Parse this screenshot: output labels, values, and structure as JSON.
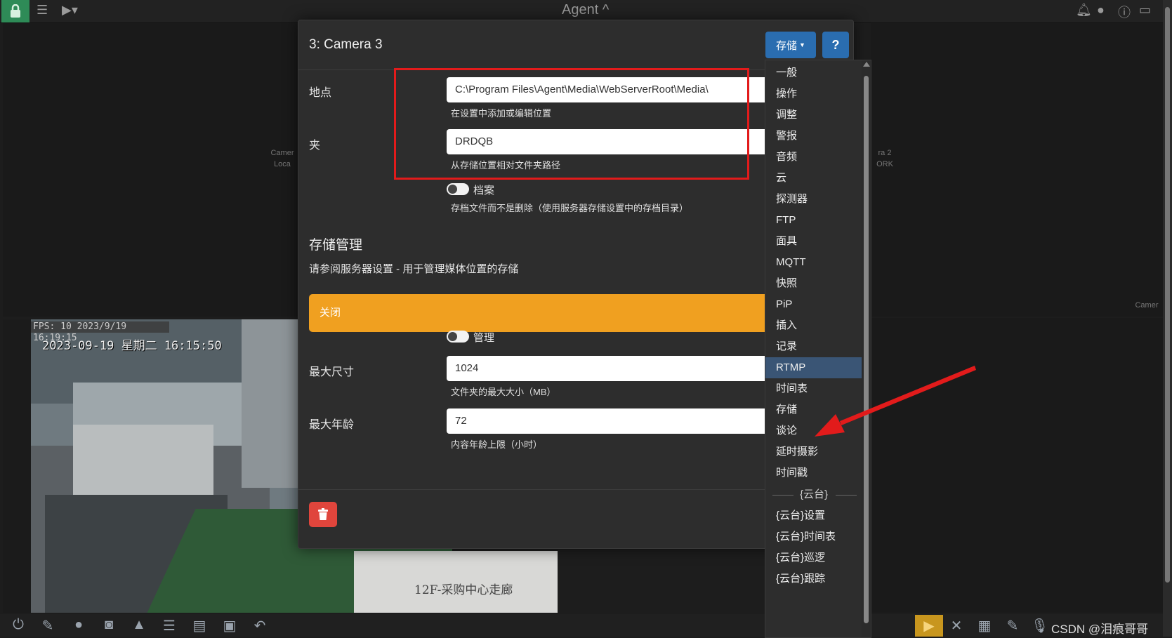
{
  "topbar": {
    "title": "Agent",
    "title_caret": "^"
  },
  "background_tiles": {
    "left_label_line1": "Camer",
    "left_label_line2": "Loca",
    "right_label_line1": "ra 2",
    "right_label_line2": "ORK",
    "right_corner_label": "Camer"
  },
  "feed": {
    "fps_text": "FPS: 10 2023/9/19 16:19:15",
    "osd_time": "2023-09-19 星期二 16:15:50",
    "osd_location": "12F-采购中心走廊"
  },
  "modal": {
    "title": "3: Camera 3",
    "storage_button": "存储",
    "help_button": "?",
    "location_label": "地点",
    "location_value": "C:\\Program Files\\Agent\\Media\\WebServerRoot\\Media\\",
    "location_hint": "在设置中添加或编辑位置",
    "folder_label": "夹",
    "folder_value": "DRDQB",
    "folder_hint": "从存储位置相对文件夹路径",
    "archive_label": "档案",
    "archive_hint": "存档文件而不是删除（使用服务器存储设置中的存档目录）",
    "section_title": "存储管理",
    "section_text": "请参阅服务器设置 - 用于管理媒体位置的存储",
    "warning_text": "关闭",
    "manage_label": "管理",
    "max_size_label": "最大尺寸",
    "max_size_value": "1024",
    "max_size_hint": "文件夹的最大大小（MB）",
    "max_age_label": "最大年龄",
    "max_age_value": "72",
    "max_age_hint": "内容年龄上限（小时）"
  },
  "dropdown": {
    "items": [
      "一般",
      "操作",
      "调整",
      "警报",
      "音频",
      "云",
      "探测器",
      "FTP",
      "面具",
      "MQTT",
      "快照",
      "PiP",
      "插入",
      "记录",
      "RTMP",
      "时间表",
      "存储",
      "谈论",
      "延时摄影",
      "时间戳"
    ],
    "active_item": "RTMP",
    "ptz_header": "{云台}",
    "ptz_items": [
      "{云台}设置",
      "{云台}时间表",
      "{云台}巡逻",
      "{云台}跟踪"
    ]
  },
  "watermark": "CSDN @泪痕哥哥",
  "colors": {
    "accent": "#2a6db0",
    "warning": "#f0a020",
    "danger": "#e0453c",
    "annotation": "#e21b1b",
    "lock": "#2e8b57"
  }
}
